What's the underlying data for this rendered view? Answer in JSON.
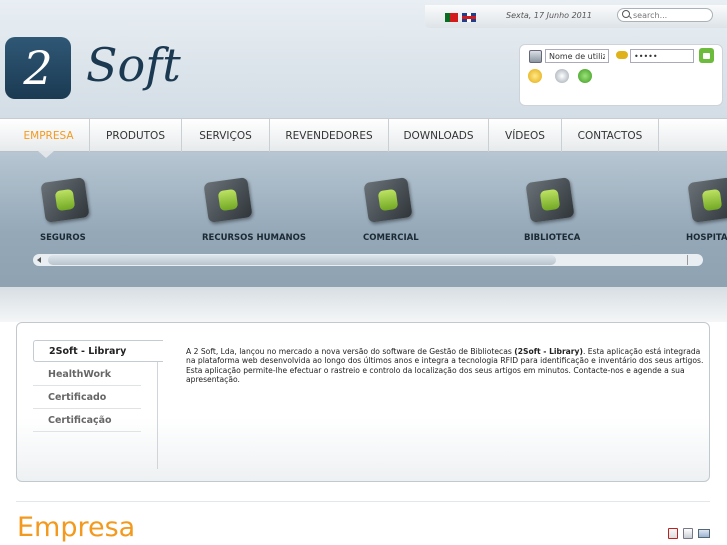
{
  "topbar": {
    "date": "Sexta, 17 Junho 2011",
    "search_placeholder": "search..."
  },
  "logo": {
    "mark": "2",
    "text": "Soft"
  },
  "login": {
    "username_value": "Nome de utilizador",
    "password_value": "•••••"
  },
  "nav": {
    "items": [
      "EMPRESA",
      "PRODUTOS",
      "SERVIÇOS",
      "REVENDEDORES",
      "DOWNLOADS",
      "VÍDEOS",
      "CONTACTOS"
    ],
    "active": "EMPRESA"
  },
  "slider": {
    "items": [
      "SEGUROS",
      "RECURSOS HUMANOS",
      "COMERCIAL",
      "BIBLIOTECA",
      "HOSPITALAR"
    ]
  },
  "side_tabs": [
    "2Soft - Library",
    "HealthWork",
    "Certificado",
    "Certificação"
  ],
  "content": {
    "p1": "A 2 Soft, Lda, lançou no mercado a nova versão do software de Gestão de Bibliotecas ",
    "bold": "(2Soft - Library)",
    "p2": ". Esta aplicação está integrada na plataforma web desenvolvida ao longo dos últimos anos e integra a tecnologia RFID para identificação e inventário dos seus artigos. Esta aplicação permite-lhe efectuar o rastreio e controlo da localização dos seus artigos em minutos. Contacte-nos e agende a sua apresentação."
  },
  "page_title": "Empresa",
  "colors": {
    "accent": "#f39a1e",
    "brand": "#1b3a52"
  },
  "icons": {
    "pdf": "pdf-icon",
    "print": "print-icon",
    "email": "email-icon"
  }
}
